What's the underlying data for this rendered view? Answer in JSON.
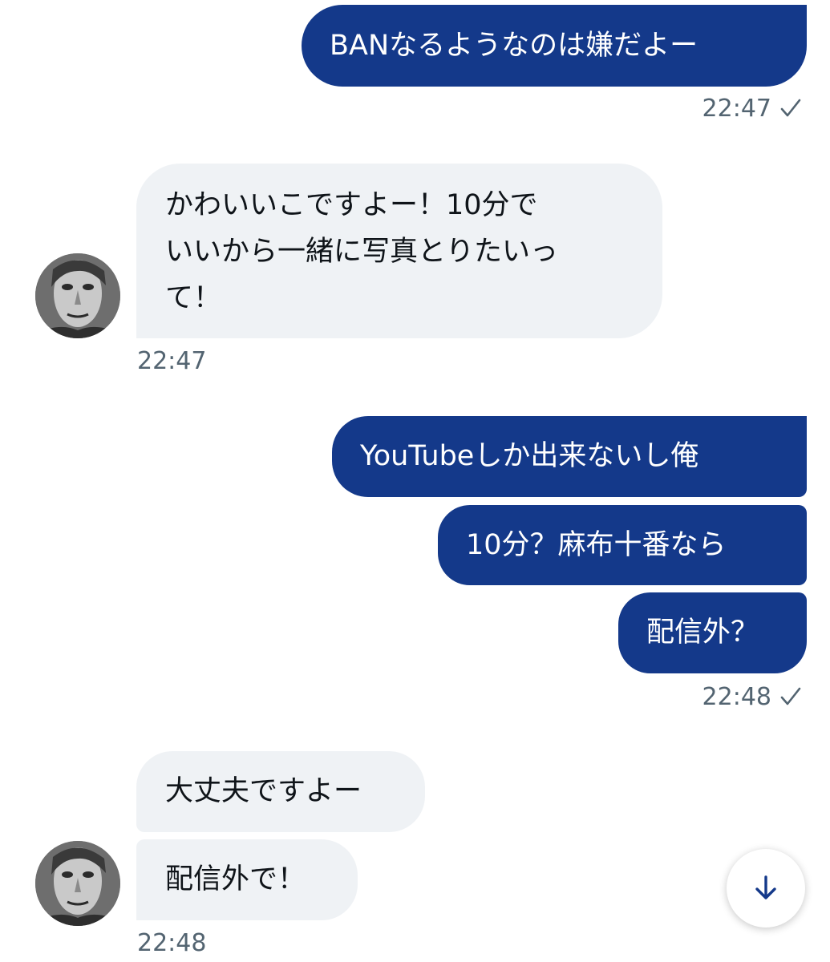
{
  "messages": [
    {
      "direction": "outgoing",
      "text": "BANなるようなのは嫌だよー"
    },
    {
      "direction": "outgoing_time",
      "time": "22:47"
    },
    {
      "direction": "incoming",
      "lines": [
        "かわいいこですよー！10分で",
        "いいから一緒に写真とりたいっ",
        "て！"
      ]
    },
    {
      "direction": "incoming_time",
      "time": "22:47"
    },
    {
      "direction": "outgoing",
      "text": "YouTubeしか出来ないし俺"
    },
    {
      "direction": "outgoing",
      "text": "10分？麻布十番なら"
    },
    {
      "direction": "outgoing",
      "text": "配信外？"
    },
    {
      "direction": "outgoing_time",
      "time": "22:48"
    },
    {
      "direction": "incoming",
      "text": "大丈夫ですよー"
    },
    {
      "direction": "incoming",
      "text": "配信外で！"
    },
    {
      "direction": "incoming_time",
      "time": "22:48"
    }
  ],
  "icons": {
    "read_receipt": "check-icon",
    "scroll_down": "arrow-down-icon",
    "avatar": "avatar"
  },
  "colors": {
    "outgoing_bubble": "#14398a",
    "incoming_bubble": "#eff2f5",
    "timestamp": "#536471"
  }
}
